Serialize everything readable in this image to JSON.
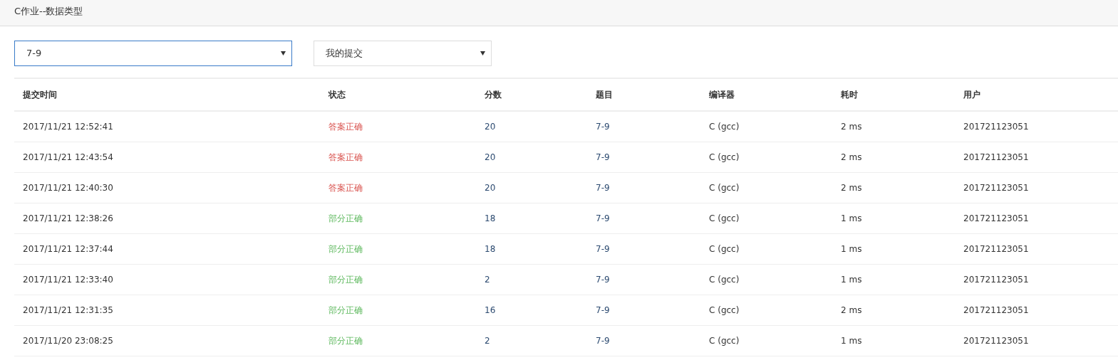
{
  "header": {
    "title": "C作业--数据类型"
  },
  "filters": [
    {
      "value": "7-9",
      "focused": true
    },
    {
      "value": "我的提交",
      "focused": false
    }
  ],
  "table": {
    "columns": [
      "提交时间",
      "状态",
      "分数",
      "题目",
      "编译器",
      "耗时",
      "用户"
    ],
    "rows": [
      {
        "time": "2017/11/21 12:52:41",
        "status": {
          "text": "答案正确",
          "color": "#d9534f"
        },
        "score": "20",
        "problem": "7-9",
        "compiler": "C (gcc)",
        "duration": "2 ms",
        "user": "201721123051"
      },
      {
        "time": "2017/11/21 12:43:54",
        "status": {
          "text": "答案正确",
          "color": "#d9534f"
        },
        "score": "20",
        "problem": "7-9",
        "compiler": "C (gcc)",
        "duration": "2 ms",
        "user": "201721123051"
      },
      {
        "time": "2017/11/21 12:40:30",
        "status": {
          "text": "答案正确",
          "color": "#d9534f"
        },
        "score": "20",
        "problem": "7-9",
        "compiler": "C (gcc)",
        "duration": "2 ms",
        "user": "201721123051"
      },
      {
        "time": "2017/11/21 12:38:26",
        "status": {
          "text": "部分正确",
          "color": "#5cb85c"
        },
        "score": "18",
        "problem": "7-9",
        "compiler": "C (gcc)",
        "duration": "1 ms",
        "user": "201721123051"
      },
      {
        "time": "2017/11/21 12:37:44",
        "status": {
          "text": "部分正确",
          "color": "#5cb85c"
        },
        "score": "18",
        "problem": "7-9",
        "compiler": "C (gcc)",
        "duration": "1 ms",
        "user": "201721123051"
      },
      {
        "time": "2017/11/21 12:33:40",
        "status": {
          "text": "部分正确",
          "color": "#5cb85c"
        },
        "score": "2",
        "problem": "7-9",
        "compiler": "C (gcc)",
        "duration": "1 ms",
        "user": "201721123051"
      },
      {
        "time": "2017/11/21 12:31:35",
        "status": {
          "text": "部分正确",
          "color": "#5cb85c"
        },
        "score": "16",
        "problem": "7-9",
        "compiler": "C (gcc)",
        "duration": "2 ms",
        "user": "201721123051"
      },
      {
        "time": "2017/11/20 23:08:25",
        "status": {
          "text": "部分正确",
          "color": "#5cb85c"
        },
        "score": "2",
        "problem": "7-9",
        "compiler": "C (gcc)",
        "duration": "1 ms",
        "user": "201721123051"
      }
    ]
  }
}
